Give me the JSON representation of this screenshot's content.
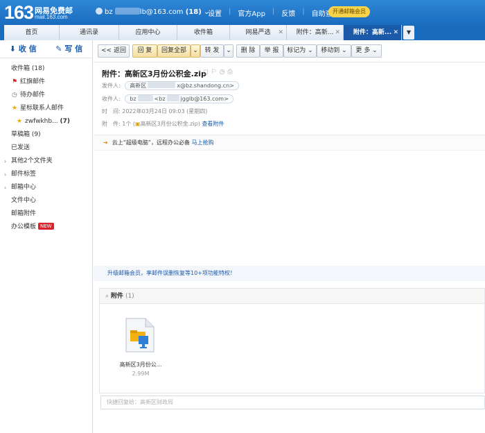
{
  "brand": {
    "logo_num": "163",
    "logo_text": "网易免费邮",
    "logo_domain": "mail.163.com"
  },
  "header": {
    "user_prefix": "bz",
    "user_suffix": "lb@163.com",
    "unread": "(18)",
    "links": [
      "设置",
      "官方App",
      "反馈",
      "自助查询"
    ],
    "vip_button": "开通邮箱会员"
  },
  "tabs": [
    {
      "label": "首页"
    },
    {
      "label": "通讯录"
    },
    {
      "label": "应用中心"
    },
    {
      "label": "收件箱"
    },
    {
      "label": "网易严选"
    },
    {
      "label": "附件：高新..."
    },
    {
      "label": "附件：高新..."
    }
  ],
  "sidebar": {
    "receive": "收 信",
    "compose": "写 信",
    "items": [
      {
        "label": "收件箱 (18)"
      },
      {
        "label": "红旗邮件"
      },
      {
        "label": "待办邮件"
      },
      {
        "label": "星标联系人邮件"
      },
      {
        "label": "zwfwkhb..."
      },
      {
        "label": "(7)"
      },
      {
        "label": "草稿箱 (9)"
      },
      {
        "label": "已发送"
      },
      {
        "label": "其他2个文件夹"
      },
      {
        "label": "邮件标签"
      },
      {
        "label": "邮箱中心"
      },
      {
        "label": "文件中心"
      },
      {
        "label": "邮箱附件"
      },
      {
        "label": "办公模板"
      }
    ],
    "new_badge": "NEW"
  },
  "toolbar": {
    "back": "<< 返回",
    "reply": "回 复",
    "reply_all": "回复全部",
    "forward": "转 发",
    "delete": "删 除",
    "report": "举 报",
    "mark": "标记为",
    "move": "移动到",
    "more": "更 多"
  },
  "mail": {
    "subject": "附件：高新区3月份公积金.zip",
    "from_label": "发件人:",
    "from_name": "高新区",
    "from_addr": "x@bz.shandong.cn>",
    "to_label": "收件人:",
    "to_name": "bz",
    "to_addr": "<bz",
    "to_addr2": "jgglb@163.com>",
    "time_label": "时　间:",
    "time_value": "2022年03月24日 09:03 (星期四)",
    "attach_label": "附　件:",
    "attach_value": "1个 (",
    "attach_file": "高新区3月份公积金.zip",
    "attach_close": ")",
    "view_attach": "查看附件"
  },
  "promo": {
    "text": "云上“超级电脑”，远程办公必备",
    "link": "马上抢购"
  },
  "upgrade": {
    "text": "升级邮箱会员，享邮件误删恢复等10+项功能特权！"
  },
  "attachment": {
    "title": "附件",
    "count": "(1)",
    "file_name": "高新区3月份公...",
    "file_size": "2.99M"
  },
  "quick_reply": {
    "placeholder": "快捷回复给：高新区财政局"
  }
}
